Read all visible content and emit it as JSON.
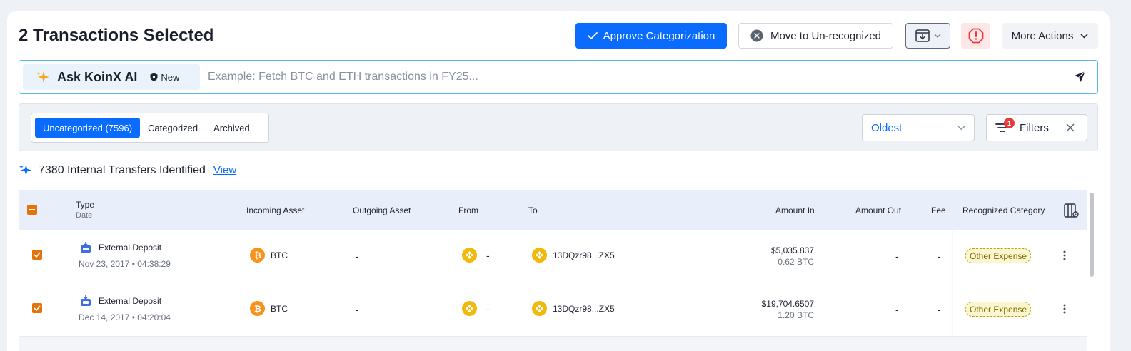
{
  "header": {
    "title": "2 Transactions Selected",
    "approve_label": "Approve Categorization",
    "move_label": "Move to Un-recognized",
    "more_actions_label": "More Actions"
  },
  "ai_bar": {
    "name": "Ask KoinX AI",
    "badge": "New",
    "placeholder": "Example: Fetch BTC and ETH transactions in FY25..."
  },
  "tabs": [
    {
      "label": "Uncategorized (7596)",
      "active": true
    },
    {
      "label": "Categorized",
      "active": false
    },
    {
      "label": "Archived",
      "active": false
    }
  ],
  "sort": {
    "selected": "Oldest"
  },
  "filters": {
    "label": "Filters",
    "count": "1"
  },
  "internal_transfers": {
    "text": "7380 Internal Transfers Identified",
    "link": "View"
  },
  "table": {
    "columns": {
      "type": "Type",
      "date": "Date",
      "incoming": "Incoming Asset",
      "outgoing": "Outgoing Asset",
      "from": "From",
      "to": "To",
      "amount_in": "Amount In",
      "amount_out": "Amount Out",
      "fee": "Fee",
      "category": "Recognized Category"
    },
    "rows": [
      {
        "type": "External Deposit",
        "date": "Nov 23, 2017 • 04:38:29",
        "incoming": "BTC",
        "outgoing": "-",
        "from": "-",
        "to": "13DQzr98...ZX5",
        "amount_in_usd": "$5,035.837",
        "amount_in_asset": "0.62 BTC",
        "amount_out": "-",
        "fee": "-",
        "category": "Other Expense"
      },
      {
        "type": "External Deposit",
        "date": "Dec 14, 2017 • 04:20:04",
        "incoming": "BTC",
        "outgoing": "-",
        "from": "-",
        "to": "13DQzr98...ZX5",
        "amount_in_usd": "$19,704.6507",
        "amount_in_asset": "1.20 BTC",
        "amount_out": "-",
        "fee": "-",
        "category": "Other Expense"
      }
    ]
  },
  "colors": {
    "primary": "#0a6cff",
    "checkbox": "#e5720b",
    "btc": "#f7931a",
    "bnb": "#f0b90b",
    "alert": "#e83a3a"
  }
}
